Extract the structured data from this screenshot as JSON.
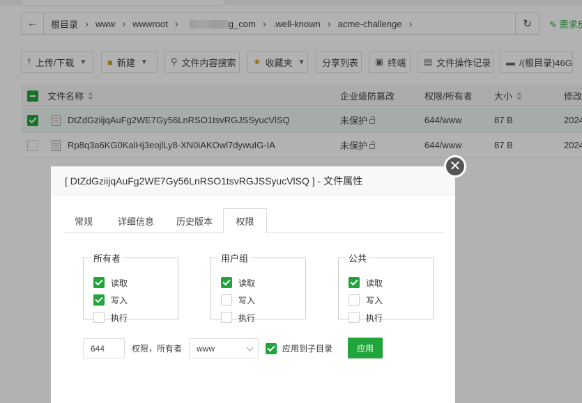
{
  "breadcrumb": {
    "items": [
      "根目录",
      "www",
      "wwwroot",
      "g_com",
      ".well-known",
      "acme-challenge"
    ]
  },
  "header": {
    "request_link": "需求反"
  },
  "toolbar": {
    "upload_label": "上传/下载",
    "new_label": "新建",
    "search_content_label": "文件内容搜索",
    "favorites_label": "收藏夹",
    "share_list_label": "分享列表",
    "terminal_label": "终端",
    "op_log_label": "文件操作记录",
    "disk_label": "/(根目录)46G"
  },
  "table": {
    "headers": [
      "文件名称",
      "企业级防篡改",
      "权限/所有者",
      "大小",
      "修改"
    ],
    "rows": [
      {
        "name": "DtZdGziijqAuFg2WE7Gy56LnRSO1tsvRGJSSyucVlSQ",
        "protect": "未保护",
        "perm": "644/www",
        "size": "87 B",
        "date": "2024",
        "selected": true
      },
      {
        "name": "Rp8q3a6KG0KalHj3eojlLy8-XN0iAKOwl7dywuIG-IA",
        "protect": "未保护",
        "perm": "644/www",
        "size": "87 B",
        "date": "2024",
        "selected": false
      }
    ]
  },
  "dialog": {
    "title": "[ DtZdGziijqAuFg2WE7Gy56LnRSO1tsvRGJSSyucVlSQ ] - 文件属性",
    "tabs": [
      "常规",
      "详细信息",
      "历史版本",
      "权限"
    ],
    "active_tab": "权限",
    "groups": [
      {
        "label": "所有者",
        "read": "读取",
        "write": "写入",
        "exec": "执行",
        "read_on": true,
        "write_on": true,
        "exec_on": false
      },
      {
        "label": "用户组",
        "read": "读取",
        "write": "写入",
        "exec": "执行",
        "read_on": true,
        "write_on": false,
        "exec_on": false
      },
      {
        "label": "公共",
        "read": "读取",
        "write": "写入",
        "exec": "执行",
        "read_on": true,
        "write_on": false,
        "exec_on": false
      }
    ],
    "mode_value": "644",
    "perm_owner_label": "权限，所有者",
    "owner_value": "www",
    "apply_subdir_label": "应用到子目录",
    "apply_subdir_checked": true,
    "apply_button": "应用"
  },
  "colors": {
    "accent": "#20a53a",
    "overlay": "rgba(0,0,0,0.3)",
    "close_button": "#555555"
  }
}
